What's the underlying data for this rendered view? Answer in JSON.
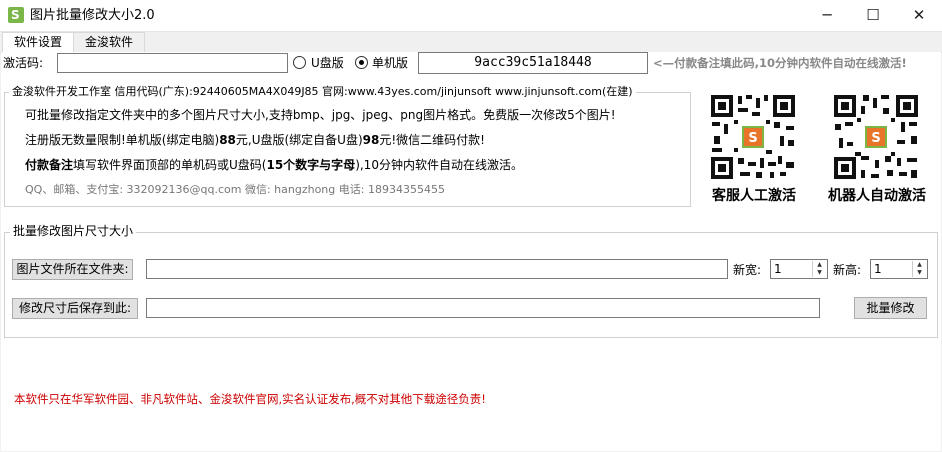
{
  "window": {
    "title": "图片批量修改大小2.0",
    "minimize": "─",
    "maximize": "☐",
    "close": "✕"
  },
  "tabs": [
    {
      "label": "软件设置"
    },
    {
      "label": "金浚软件"
    }
  ],
  "activation": {
    "code_label": "激活码:",
    "code_value": "",
    "radio_usb": "U盘版",
    "radio_pc": "单机版",
    "machine_code": "9acc39c51a18448",
    "note": "<—付款备注填此码,10分钟内软件自动在线激活!"
  },
  "info": {
    "legend": "金浚软件开发工作室 信用代码(广东):92440605MA4X049J85 官网:www.43yes.com/jinjunsoft  www.jinjunsoft.com(在建)",
    "line1": "可批量修改指定文件夹中的多个图片尺寸大小,支持bmp、jpg、jpeg、png图片格式。免费版一次修改5个图片!",
    "line2_prefix": "注册版无数量限制!单机版(绑定电脑)",
    "line2_price1": "88",
    "line2_mid": "元,U盘版(绑定自备U盘)",
    "line2_price2": "98",
    "line2_suffix": "元!微信二维码付款!",
    "line3_bold": "付款备注",
    "line3_mid": "填写软件界面顶部的单机码或U盘码(",
    "line3_bold2": "15个数字与字母",
    "line3_suffix": "),10分钟内软件自动在线激活。",
    "contact": "QQ、邮箱、支付宝: 332092136@qq.com   微信: hangzhong   电话: 18934355455"
  },
  "qr": [
    {
      "caption": "客服人工激活"
    },
    {
      "caption": "机器人自动激活"
    }
  ],
  "resize": {
    "legend": "批量修改图片尺寸大小",
    "src_button": "图片文件所在文件夹:",
    "src_value": "",
    "width_label": "新宽:",
    "width_value": "1",
    "height_label": "新高:",
    "height_value": "1",
    "dst_button": "修改尺寸后保存到此:",
    "dst_value": "",
    "run_button": "批量修改"
  },
  "footer": {
    "notice": "本软件只在华军软件园、非凡软件站、金浚软件官网,实名认证发布,概不对其他下载途径负责!"
  },
  "colors": {
    "notice_red": "#cc0000",
    "logo_green": "#7ab648",
    "logo_orange": "#e8742a"
  }
}
